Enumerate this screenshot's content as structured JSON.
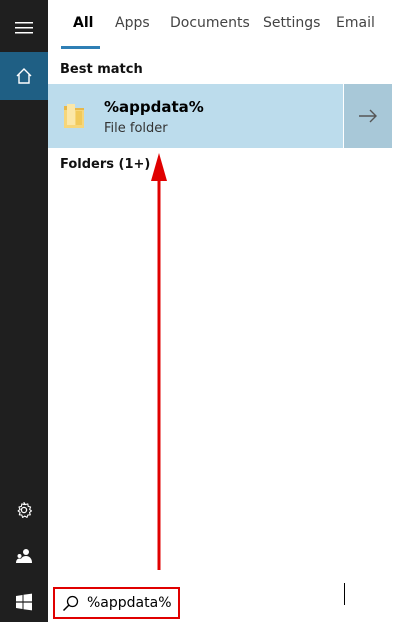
{
  "tabs": [
    {
      "label": "All"
    },
    {
      "label": "Apps"
    },
    {
      "label": "Documents"
    },
    {
      "label": "Settings"
    },
    {
      "label": "Email"
    }
  ],
  "best_match": {
    "heading": "Best match",
    "title": "%appdata%",
    "subtitle": "File folder"
  },
  "folders": {
    "heading": "Folders (1+)"
  },
  "search": {
    "value": "%appdata%"
  },
  "icons": {
    "menu": "hamburger-icon",
    "home": "home-icon",
    "settings": "gear-icon",
    "people": "person-icon",
    "windows": "windows-logo-icon",
    "search": "search-icon",
    "arrow": "arrow-right-icon",
    "folder": "folder-icon"
  },
  "colors": {
    "accent": "#2f7fb5",
    "selected_row": "#bcdcec",
    "annotation": "#e00000"
  }
}
